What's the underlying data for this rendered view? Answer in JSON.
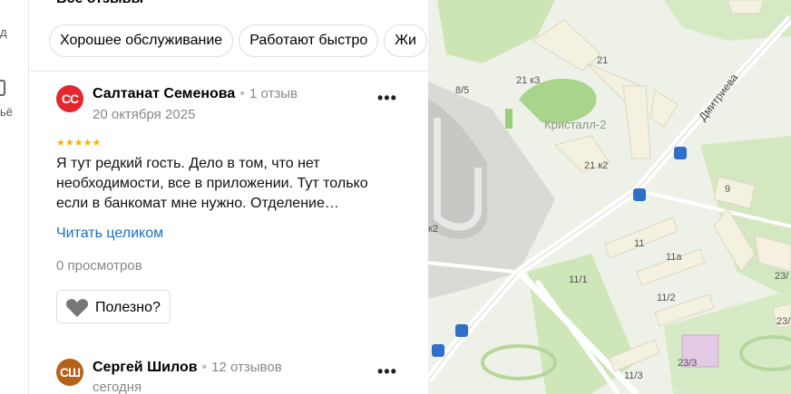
{
  "left_strip": {
    "label_d": "д",
    "label_ye": "ьё"
  },
  "panel_title": "Все отзывы",
  "chips": [
    "Хорошее обслуживание",
    "Работают быстро",
    "Жи"
  ],
  "reviews": [
    {
      "avatar_initials": "СС",
      "avatar_color": "#e3262f",
      "name": "Салтанат Семенова",
      "review_count": "1 отзыв",
      "date": "20 октября 2025",
      "stars": "★★★★★",
      "text": "Я тут редкий гость. Дело в том, что нет необходимости, все в приложении. Тут только если в банкомат мне нужно. Отделение…",
      "read_more": "Читать целиком",
      "views": "0 просмотров",
      "useful_label": "Полезно?"
    },
    {
      "avatar_initials": "СШ",
      "avatar_color": "#b5611a",
      "name": "Сергей Шилов",
      "review_count": "12 отзывов",
      "date": "сегодня"
    }
  ],
  "more_label": "•••",
  "map": {
    "street": "Дмитриева",
    "labels": [
      "21",
      "21 к3",
      "8/5",
      "Кристалл-2",
      "21 к2",
      "9",
      "11",
      "11а",
      "к2",
      "11/1",
      "11/2",
      "23/",
      "23/3",
      "11/3",
      "23/"
    ]
  }
}
